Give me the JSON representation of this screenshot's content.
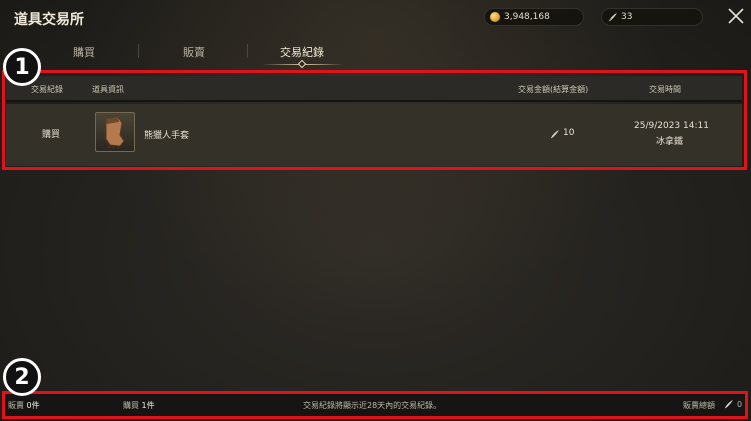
{
  "window": {
    "title": "道具交易所"
  },
  "currency": {
    "gold": "3,948,168",
    "silver": "33"
  },
  "tabs": [
    {
      "label": "購買",
      "active": false
    },
    {
      "label": "販賣",
      "active": false
    },
    {
      "label": "交易紀錄",
      "active": true
    }
  ],
  "table": {
    "headers": [
      "交易紀錄",
      "道具資訊",
      "交易金額(結算金額)",
      "交易時間"
    ],
    "rows": [
      {
        "type": "購買",
        "item_name": "熊獵人手套",
        "price": "10",
        "date": "25/9/2023 14:11",
        "trader": "冰拿鐵"
      }
    ]
  },
  "footer": {
    "sell_label": "販賣",
    "sell_count": "0件",
    "buy_label": "購買",
    "buy_count": "1件",
    "notice": "交易紀錄將顯示近28天內的交易紀錄。",
    "sell_total_label": "販賣總額",
    "sell_total_value": "0"
  },
  "annotations": {
    "badge_1": "1",
    "badge_2": "2"
  },
  "colors": {
    "highlight": "#e0121a",
    "gold": "#d69a1e"
  },
  "icons": {
    "gold": "gold-coin-icon",
    "silver": "feather-currency-icon",
    "close": "close-icon",
    "item": "gloves-item-icon"
  }
}
